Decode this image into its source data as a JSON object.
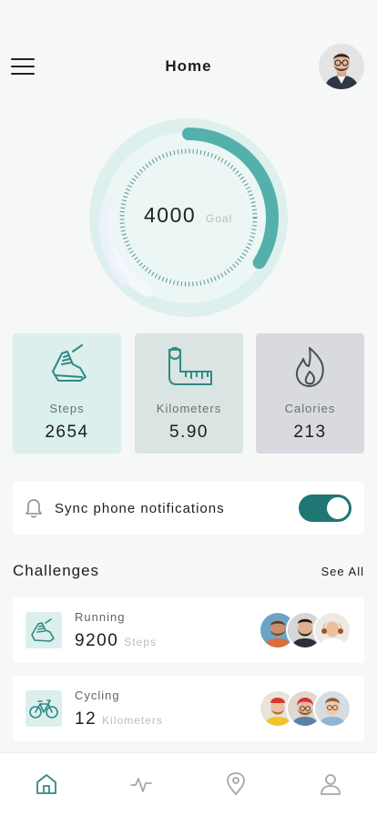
{
  "header": {
    "title": "Home"
  },
  "goal": {
    "value": "4000",
    "label": "Goal",
    "progress": 0.34
  },
  "stats": [
    {
      "label": "Steps",
      "value": "2654",
      "icon": "sneaker-icon",
      "bg": "#dcefed"
    },
    {
      "label": "Kilometers",
      "value": "5.90",
      "icon": "ruler-tape-icon",
      "bg": "#d9e4e3"
    },
    {
      "label": "Calories",
      "value": "213",
      "icon": "flame-icon",
      "bg": "#d8dadf"
    }
  ],
  "sync": {
    "label": "Sync phone notifications",
    "enabled": true
  },
  "challenges": {
    "title": "Challenges",
    "see_all": "See All",
    "items": [
      {
        "name": "Running",
        "value": "9200",
        "unit": "Steps",
        "icon": "sneaker-icon"
      },
      {
        "name": "Cycling",
        "value": "12",
        "unit": "Kilometers",
        "icon": "bicycle-icon"
      }
    ]
  },
  "tabs": [
    "home-icon",
    "activity-icon",
    "location-pin-icon",
    "profile-icon"
  ],
  "colors": {
    "accent": "#1f7672",
    "accent_light": "#54b0aa",
    "background": "#f6f7f7"
  }
}
